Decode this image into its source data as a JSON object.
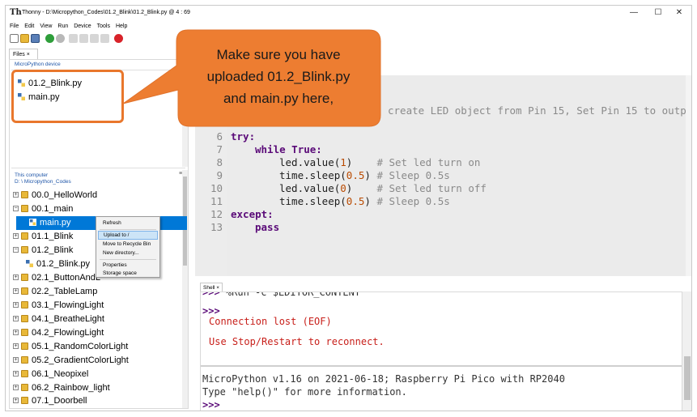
{
  "window": {
    "title": "Thonny - D:\\Micropython_Codes\\01.2_Blink\\01.2_Blink.py @ 4 : 69",
    "app_icon": "Th",
    "minimize": "—",
    "maximize": "☐",
    "close": "✕"
  },
  "menu": [
    "File",
    "Edit",
    "View",
    "Run",
    "Device",
    "Tools",
    "Help"
  ],
  "toolbar": {
    "icons": [
      "new-file-icon",
      "open-file-icon",
      "save-icon",
      "run-icon",
      "debug-icon",
      "step-over-icon",
      "step-into-icon",
      "step-out-icon",
      "resume-icon",
      "stop-icon"
    ],
    "colors": {
      "run": "#2e9e3a",
      "stop": "#d8232a"
    }
  },
  "files_panel": {
    "tab_label": "Files ×",
    "device_header": "MicroPython device",
    "device_files": [
      "01.2_Blink.py",
      "main.py"
    ],
    "computer_header": "This computer",
    "computer_path": "D: \\ Micropython_Codes",
    "tree": [
      {
        "label": "00.0_HelloWorld",
        "expander": "+",
        "type": "folder"
      },
      {
        "label": "00.1_main",
        "expander": "−",
        "type": "folder"
      },
      {
        "label": "main.py",
        "type": "file",
        "selected": true
      },
      {
        "label": "01.1_Blink",
        "expander": "+",
        "type": "folder"
      },
      {
        "label": "01.2_Blink",
        "expander": "−",
        "type": "folder"
      },
      {
        "label": "01.2_Blink.py",
        "type": "file"
      },
      {
        "label": "02.1_ButtonAndL",
        "expander": "+",
        "type": "folder"
      },
      {
        "label": "02.2_TableLamp",
        "expander": "+",
        "type": "folder"
      },
      {
        "label": "03.1_FlowingLight",
        "expander": "+",
        "type": "folder"
      },
      {
        "label": "04.1_BreatheLight",
        "expander": "+",
        "type": "folder"
      },
      {
        "label": "04.2_FlowingLight",
        "expander": "+",
        "type": "folder"
      },
      {
        "label": "05.1_RandomColorLight",
        "expander": "+",
        "type": "folder"
      },
      {
        "label": "05.2_GradientColorLight",
        "expander": "+",
        "type": "folder"
      },
      {
        "label": "06.1_Neopixel",
        "expander": "+",
        "type": "folder"
      },
      {
        "label": "06.2_Rainbow_light",
        "expander": "+",
        "type": "folder"
      },
      {
        "label": "07.1_Doorbell",
        "expander": "+",
        "type": "folder"
      }
    ],
    "pane_menu": "≡"
  },
  "context_menu": {
    "items": [
      "Refresh",
      "Upload to /",
      "Move to Recycle Bin",
      "New directory...",
      "Properties",
      "Storage space"
    ]
  },
  "editor": {
    "visible_fragment": "create LED object from Pin 15, Set Pin 15 to outp",
    "lines": [
      {
        "n": "6"
      },
      {
        "n": "7"
      },
      {
        "n": "8",
        "code": "led.value(",
        "arg": "1",
        "close": ")",
        "comment": "# Set led turn on"
      },
      {
        "n": "9",
        "code": "time.sleep(",
        "arg": "0.5",
        "close": ")",
        "comment": "# Sleep 0.5s"
      },
      {
        "n": "10",
        "code": "led.value(",
        "arg": "0",
        "close": ")",
        "comment": "# Set led turn off"
      },
      {
        "n": "11",
        "code": "time.sleep(",
        "arg": "0.5",
        "close": ")",
        "comment": "# Sleep 0.5s"
      },
      {
        "n": "12"
      },
      {
        "n": "13"
      }
    ],
    "kw_try": "try:",
    "kw_while": "while",
    "kw_true": "True",
    "colon": ":",
    "kw_except": "except:",
    "kw_pass": "pass"
  },
  "shell": {
    "tab_label": "Shell ×",
    "cut_line": "%Run -c $EDITOR_CONTENT",
    "prompt": ">>>",
    "error1": "Connection lost (EOF)",
    "error2": "Use Stop/Restart to reconnect.",
    "banner1": "MicroPython v1.16 on 2021-06-18; Raspberry Pi Pico with RP2040",
    "banner2": "Type \"help()\" for more information."
  },
  "callout": {
    "line1": "Make sure you have",
    "line2": "uploaded 01.2_Blink.py",
    "line3": "and main.py here,",
    "fill": "#ed7d31",
    "stroke": "#e9772c"
  }
}
